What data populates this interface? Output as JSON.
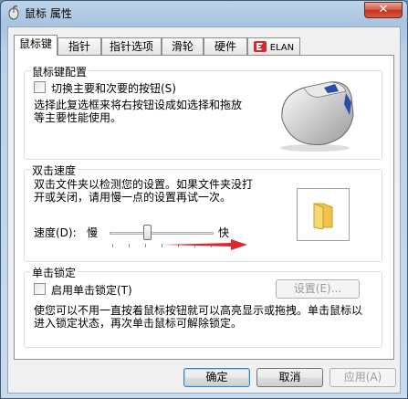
{
  "window": {
    "title": "鼠标 属性",
    "close_label": "✕"
  },
  "tabs": [
    {
      "label": "鼠标键",
      "active": true
    },
    {
      "label": "指针"
    },
    {
      "label": "指针选项"
    },
    {
      "label": "滑轮"
    },
    {
      "label": "硬件"
    },
    {
      "label": "ELAN"
    }
  ],
  "button_config": {
    "title": "鼠标键配置",
    "switch_checkbox_label": "切换主要和次要的按钮(S)",
    "switch_checked": false,
    "description": "选择此复选框来将右按钮设成如选择和拖放等主要性能使用。"
  },
  "double_click": {
    "title": "双击速度",
    "description": "双击文件夹以检测您的设置。如果文件夹没打开或关闭，请用慢一点的设置再试一次。",
    "speed_label": "速度(D):",
    "slow_label": "慢",
    "fast_label": "快",
    "speed_value_fraction": 0.36
  },
  "click_lock": {
    "title": "单击锁定",
    "enable_checkbox_label": "启用单击锁定(T)",
    "enable_checked": false,
    "settings_button": "设置(E)...",
    "description": "使您可以不用一直按着鼠标按钮就可以高亮显示或拖拽。单击鼠标以进入锁定状态，再次单击鼠标可解除锁定。"
  },
  "footer": {
    "ok": "确定",
    "cancel": "取消",
    "apply": "应用(A)"
  },
  "colors": {
    "arrow": "#e0262b",
    "folder": "#f0c44c"
  }
}
